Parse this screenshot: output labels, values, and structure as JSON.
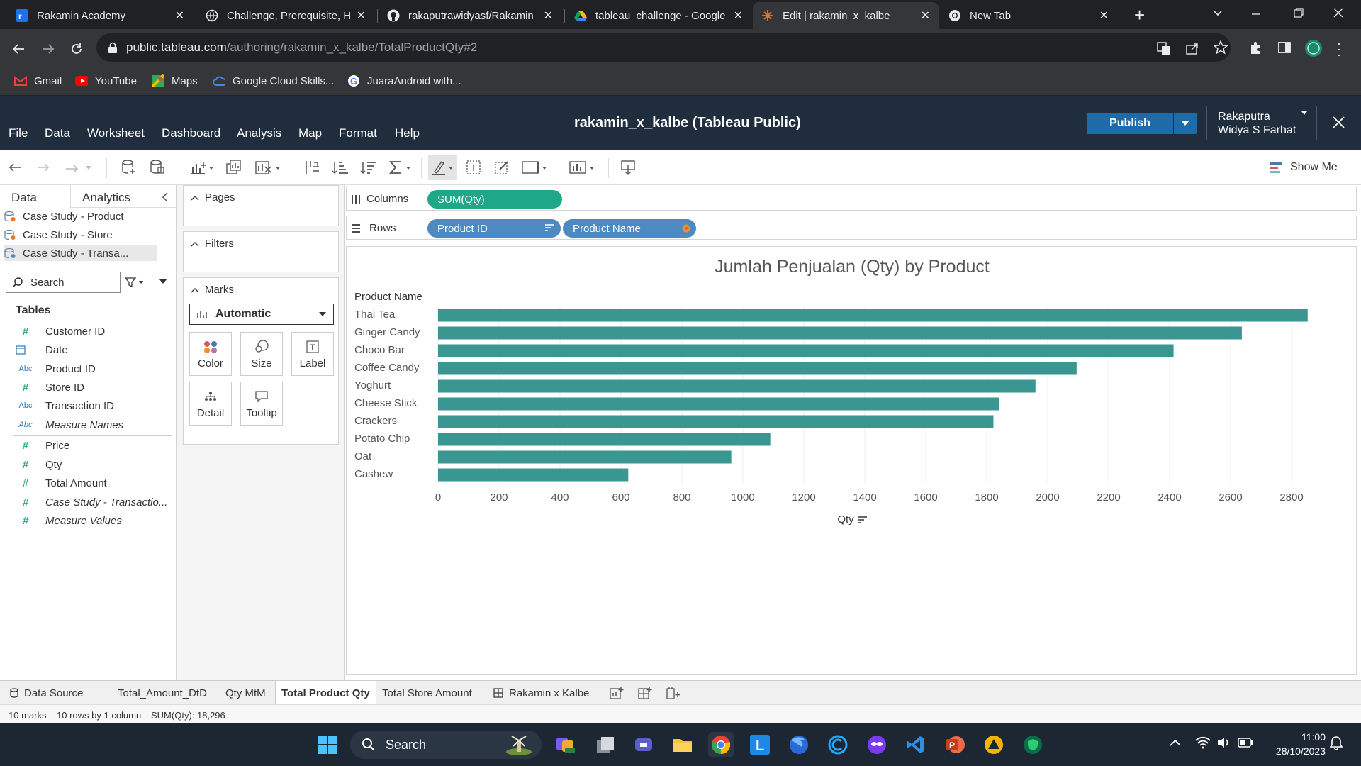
{
  "browser": {
    "tabs": [
      {
        "title": "Rakamin Academy",
        "icon": "rakamin-icon"
      },
      {
        "title": "Challenge, Prerequisite, Hi",
        "icon": "globe-icon"
      },
      {
        "title": "rakaputrawidyasf/Rakamin",
        "icon": "github-icon"
      },
      {
        "title": "tableau_challenge - Google",
        "icon": "drive-icon"
      },
      {
        "title": "Edit | rakamin_x_kalbe",
        "icon": "tableau-icon"
      },
      {
        "title": "New Tab",
        "icon": "chrome-icon"
      }
    ],
    "url_host": "public.tableau.com",
    "url_path": "/authoring/rakamin_x_kalbe/TotalProductQty#2",
    "bookmarks": [
      "Gmail",
      "YouTube",
      "Maps",
      "Google Cloud Skills...",
      "JuaraAndroid with..."
    ]
  },
  "app": {
    "menu": [
      "File",
      "Data",
      "Worksheet",
      "Dashboard",
      "Analysis",
      "Map",
      "Format",
      "Help"
    ],
    "title": "rakamin_x_kalbe (Tableau Public)",
    "publish_label": "Publish",
    "user_line1": "Rakaputra",
    "user_line2": "Widya S Farhat",
    "show_me": "Show Me"
  },
  "data_pane": {
    "tabs": [
      "Data",
      "Analytics"
    ],
    "datasources": [
      "Case Study - Product",
      "Case Study - Store",
      "Case Study - Transa..."
    ],
    "search_placeholder": "Search",
    "tables_header": "Tables",
    "fields": [
      {
        "name": "Customer ID",
        "type": "#",
        "italic": false
      },
      {
        "name": "Date",
        "type": "date",
        "italic": false
      },
      {
        "name": "Product ID",
        "type": "Abc",
        "italic": false
      },
      {
        "name": "Store ID",
        "type": "#",
        "italic": false
      },
      {
        "name": "Transaction ID",
        "type": "Abc",
        "italic": false
      },
      {
        "name": "Measure Names",
        "type": "Abc",
        "italic": true
      },
      {
        "name": "Price",
        "type": "#",
        "italic": false
      },
      {
        "name": "Qty",
        "type": "#",
        "italic": false
      },
      {
        "name": "Total Amount",
        "type": "#",
        "italic": false
      },
      {
        "name": "Case Study - Transactio...",
        "type": "#",
        "italic": true
      },
      {
        "name": "Measure Values",
        "type": "#",
        "italic": true
      }
    ]
  },
  "cards": {
    "pages": "Pages",
    "filters": "Filters",
    "marks": "Marks",
    "mark_type": "Automatic",
    "buttons": [
      "Color",
      "Size",
      "Label",
      "Detail",
      "Tooltip"
    ]
  },
  "shelves": {
    "columns_label": "Columns",
    "rows_label": "Rows",
    "columns_pills": [
      "SUM(Qty)"
    ],
    "rows_pills": [
      "Product ID",
      "Product Name"
    ]
  },
  "chart_data": {
    "type": "bar",
    "orientation": "horizontal",
    "title": "Jumlah Penjualan (Qty) by Product",
    "row_header": "Product Name",
    "xlabel": "Qty",
    "categories": [
      "Thai Tea",
      "Ginger Candy",
      "Choco Bar",
      "Coffee Candy",
      "Yoghurt",
      "Cheese Stick",
      "Crackers",
      "Potato Chip",
      "Oat",
      "Cashew"
    ],
    "values": [
      2853,
      2637,
      2413,
      2095,
      1960,
      1840,
      1822,
      1090,
      962,
      624
    ],
    "xlim": [
      0,
      2900
    ],
    "xticks": [
      0,
      200,
      400,
      600,
      800,
      1000,
      1200,
      1400,
      1600,
      1800,
      2000,
      2200,
      2400,
      2600,
      2800
    ],
    "bar_color": "#3a9690",
    "grid": true
  },
  "sheets": {
    "data_source": "Data Source",
    "tabs": [
      "Total_Amount_DtD",
      "Qty MtM",
      "Total Product Qty",
      "Total Store Amount",
      "Rakamin x Kalbe"
    ],
    "active": "Total Product Qty"
  },
  "status": {
    "marks": "10 marks",
    "rows": "10 rows by 1 column",
    "sum": "SUM(Qty): 18,296"
  },
  "taskbar": {
    "search": "Search",
    "time": "11:00",
    "date": "28/10/2023"
  }
}
